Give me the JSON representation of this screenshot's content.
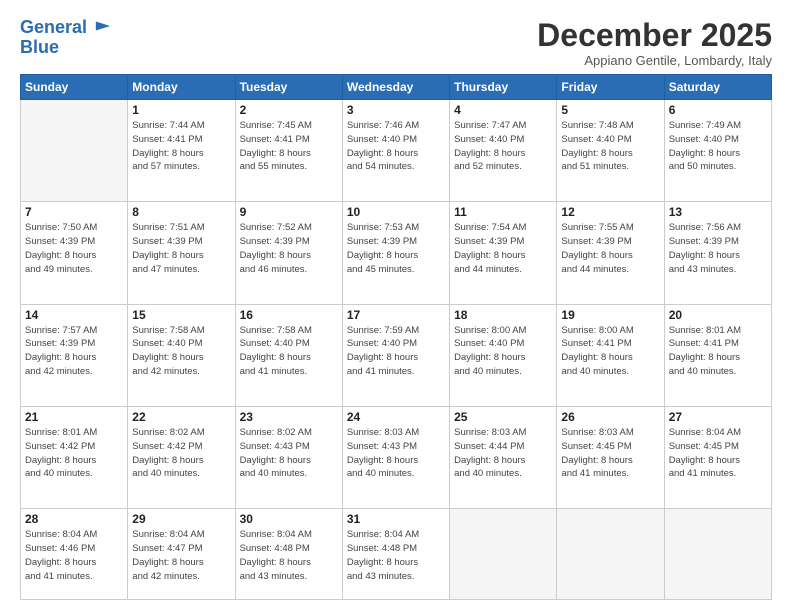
{
  "logo": {
    "line1": "General",
    "line2": "Blue"
  },
  "title": "December 2025",
  "location": "Appiano Gentile, Lombardy, Italy",
  "weekdays": [
    "Sunday",
    "Monday",
    "Tuesday",
    "Wednesday",
    "Thursday",
    "Friday",
    "Saturday"
  ],
  "weeks": [
    [
      {
        "day": "",
        "info": ""
      },
      {
        "day": "1",
        "info": "Sunrise: 7:44 AM\nSunset: 4:41 PM\nDaylight: 8 hours\nand 57 minutes."
      },
      {
        "day": "2",
        "info": "Sunrise: 7:45 AM\nSunset: 4:41 PM\nDaylight: 8 hours\nand 55 minutes."
      },
      {
        "day": "3",
        "info": "Sunrise: 7:46 AM\nSunset: 4:40 PM\nDaylight: 8 hours\nand 54 minutes."
      },
      {
        "day": "4",
        "info": "Sunrise: 7:47 AM\nSunset: 4:40 PM\nDaylight: 8 hours\nand 52 minutes."
      },
      {
        "day": "5",
        "info": "Sunrise: 7:48 AM\nSunset: 4:40 PM\nDaylight: 8 hours\nand 51 minutes."
      },
      {
        "day": "6",
        "info": "Sunrise: 7:49 AM\nSunset: 4:40 PM\nDaylight: 8 hours\nand 50 minutes."
      }
    ],
    [
      {
        "day": "7",
        "info": "Sunrise: 7:50 AM\nSunset: 4:39 PM\nDaylight: 8 hours\nand 49 minutes."
      },
      {
        "day": "8",
        "info": "Sunrise: 7:51 AM\nSunset: 4:39 PM\nDaylight: 8 hours\nand 47 minutes."
      },
      {
        "day": "9",
        "info": "Sunrise: 7:52 AM\nSunset: 4:39 PM\nDaylight: 8 hours\nand 46 minutes."
      },
      {
        "day": "10",
        "info": "Sunrise: 7:53 AM\nSunset: 4:39 PM\nDaylight: 8 hours\nand 45 minutes."
      },
      {
        "day": "11",
        "info": "Sunrise: 7:54 AM\nSunset: 4:39 PM\nDaylight: 8 hours\nand 44 minutes."
      },
      {
        "day": "12",
        "info": "Sunrise: 7:55 AM\nSunset: 4:39 PM\nDaylight: 8 hours\nand 44 minutes."
      },
      {
        "day": "13",
        "info": "Sunrise: 7:56 AM\nSunset: 4:39 PM\nDaylight: 8 hours\nand 43 minutes."
      }
    ],
    [
      {
        "day": "14",
        "info": "Sunrise: 7:57 AM\nSunset: 4:39 PM\nDaylight: 8 hours\nand 42 minutes."
      },
      {
        "day": "15",
        "info": "Sunrise: 7:58 AM\nSunset: 4:40 PM\nDaylight: 8 hours\nand 42 minutes."
      },
      {
        "day": "16",
        "info": "Sunrise: 7:58 AM\nSunset: 4:40 PM\nDaylight: 8 hours\nand 41 minutes."
      },
      {
        "day": "17",
        "info": "Sunrise: 7:59 AM\nSunset: 4:40 PM\nDaylight: 8 hours\nand 41 minutes."
      },
      {
        "day": "18",
        "info": "Sunrise: 8:00 AM\nSunset: 4:40 PM\nDaylight: 8 hours\nand 40 minutes."
      },
      {
        "day": "19",
        "info": "Sunrise: 8:00 AM\nSunset: 4:41 PM\nDaylight: 8 hours\nand 40 minutes."
      },
      {
        "day": "20",
        "info": "Sunrise: 8:01 AM\nSunset: 4:41 PM\nDaylight: 8 hours\nand 40 minutes."
      }
    ],
    [
      {
        "day": "21",
        "info": "Sunrise: 8:01 AM\nSunset: 4:42 PM\nDaylight: 8 hours\nand 40 minutes."
      },
      {
        "day": "22",
        "info": "Sunrise: 8:02 AM\nSunset: 4:42 PM\nDaylight: 8 hours\nand 40 minutes."
      },
      {
        "day": "23",
        "info": "Sunrise: 8:02 AM\nSunset: 4:43 PM\nDaylight: 8 hours\nand 40 minutes."
      },
      {
        "day": "24",
        "info": "Sunrise: 8:03 AM\nSunset: 4:43 PM\nDaylight: 8 hours\nand 40 minutes."
      },
      {
        "day": "25",
        "info": "Sunrise: 8:03 AM\nSunset: 4:44 PM\nDaylight: 8 hours\nand 40 minutes."
      },
      {
        "day": "26",
        "info": "Sunrise: 8:03 AM\nSunset: 4:45 PM\nDaylight: 8 hours\nand 41 minutes."
      },
      {
        "day": "27",
        "info": "Sunrise: 8:04 AM\nSunset: 4:45 PM\nDaylight: 8 hours\nand 41 minutes."
      }
    ],
    [
      {
        "day": "28",
        "info": "Sunrise: 8:04 AM\nSunset: 4:46 PM\nDaylight: 8 hours\nand 41 minutes."
      },
      {
        "day": "29",
        "info": "Sunrise: 8:04 AM\nSunset: 4:47 PM\nDaylight: 8 hours\nand 42 minutes."
      },
      {
        "day": "30",
        "info": "Sunrise: 8:04 AM\nSunset: 4:48 PM\nDaylight: 8 hours\nand 43 minutes."
      },
      {
        "day": "31",
        "info": "Sunrise: 8:04 AM\nSunset: 4:48 PM\nDaylight: 8 hours\nand 43 minutes."
      },
      {
        "day": "",
        "info": ""
      },
      {
        "day": "",
        "info": ""
      },
      {
        "day": "",
        "info": ""
      }
    ]
  ]
}
